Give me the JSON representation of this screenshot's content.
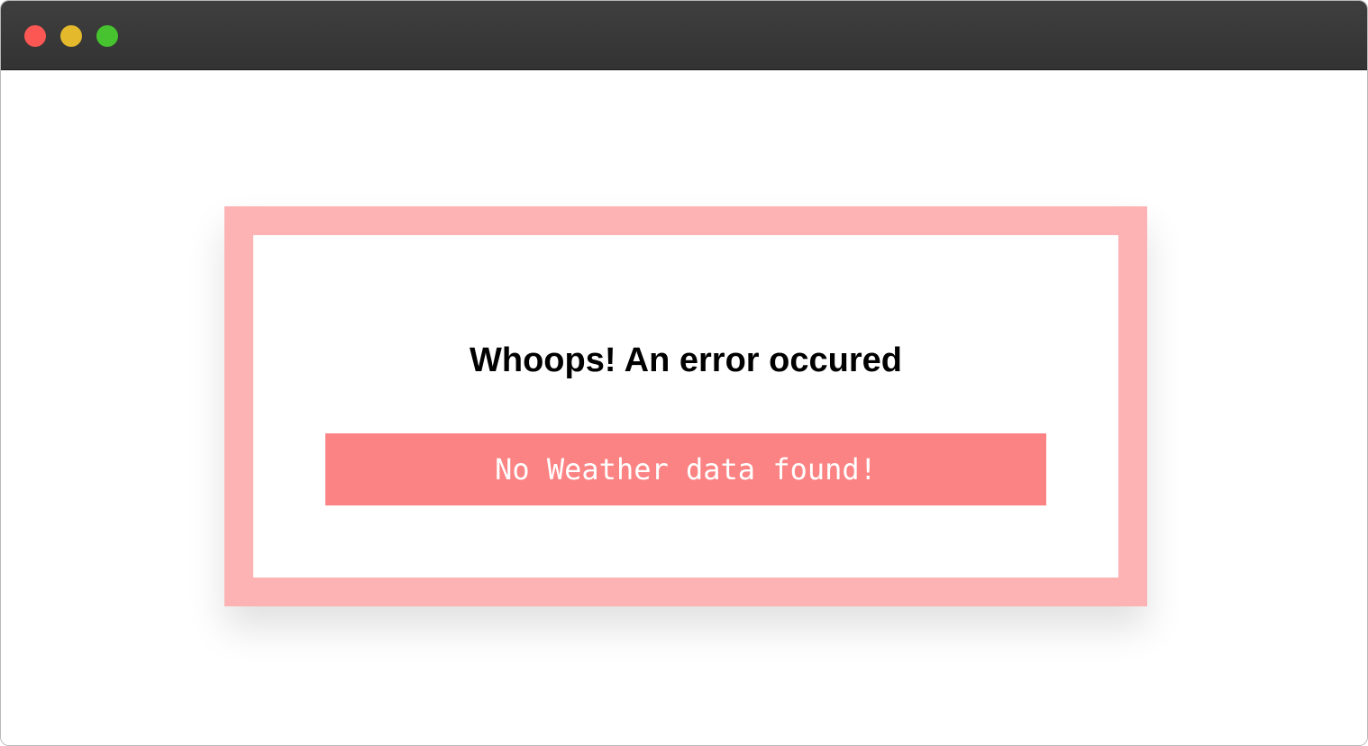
{
  "window": {
    "controls": {
      "close": "close-icon",
      "minimize": "minimize-icon",
      "zoom": "zoom-icon"
    }
  },
  "error": {
    "title": "Whoops! An error occured",
    "message": "No Weather data found!"
  },
  "colors": {
    "frame": "#fdb3b3",
    "message_bg": "#fc8383",
    "titlebar": "#383838"
  }
}
